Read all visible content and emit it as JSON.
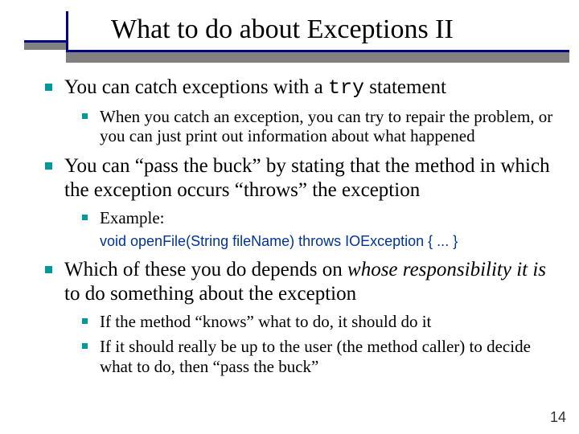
{
  "title": "What to do about Exceptions II",
  "bullets": {
    "b1_pre": "You can catch exceptions with a ",
    "b1_code": "try",
    "b1_post": " statement",
    "b1_sub1": "When you catch an exception, you can try to repair the problem, or you can just print out information about what happened",
    "b2": "You can “pass the buck” by stating that the method in which the exception occurs “throws” the exception",
    "b2_sub1": "Example:",
    "b2_code": "void openFile(String fileName) throws IOException { ... }",
    "b3_pre": "Which of these you do depends on ",
    "b3_it": "whose responsibility it is",
    "b3_post": " to do something about the exception",
    "b3_sub1": "If the method “knows” what to do, it should do it",
    "b3_sub2": "If it should really be up to the user (the method caller) to decide what to do, then “pass the buck”"
  },
  "page_number": "14"
}
